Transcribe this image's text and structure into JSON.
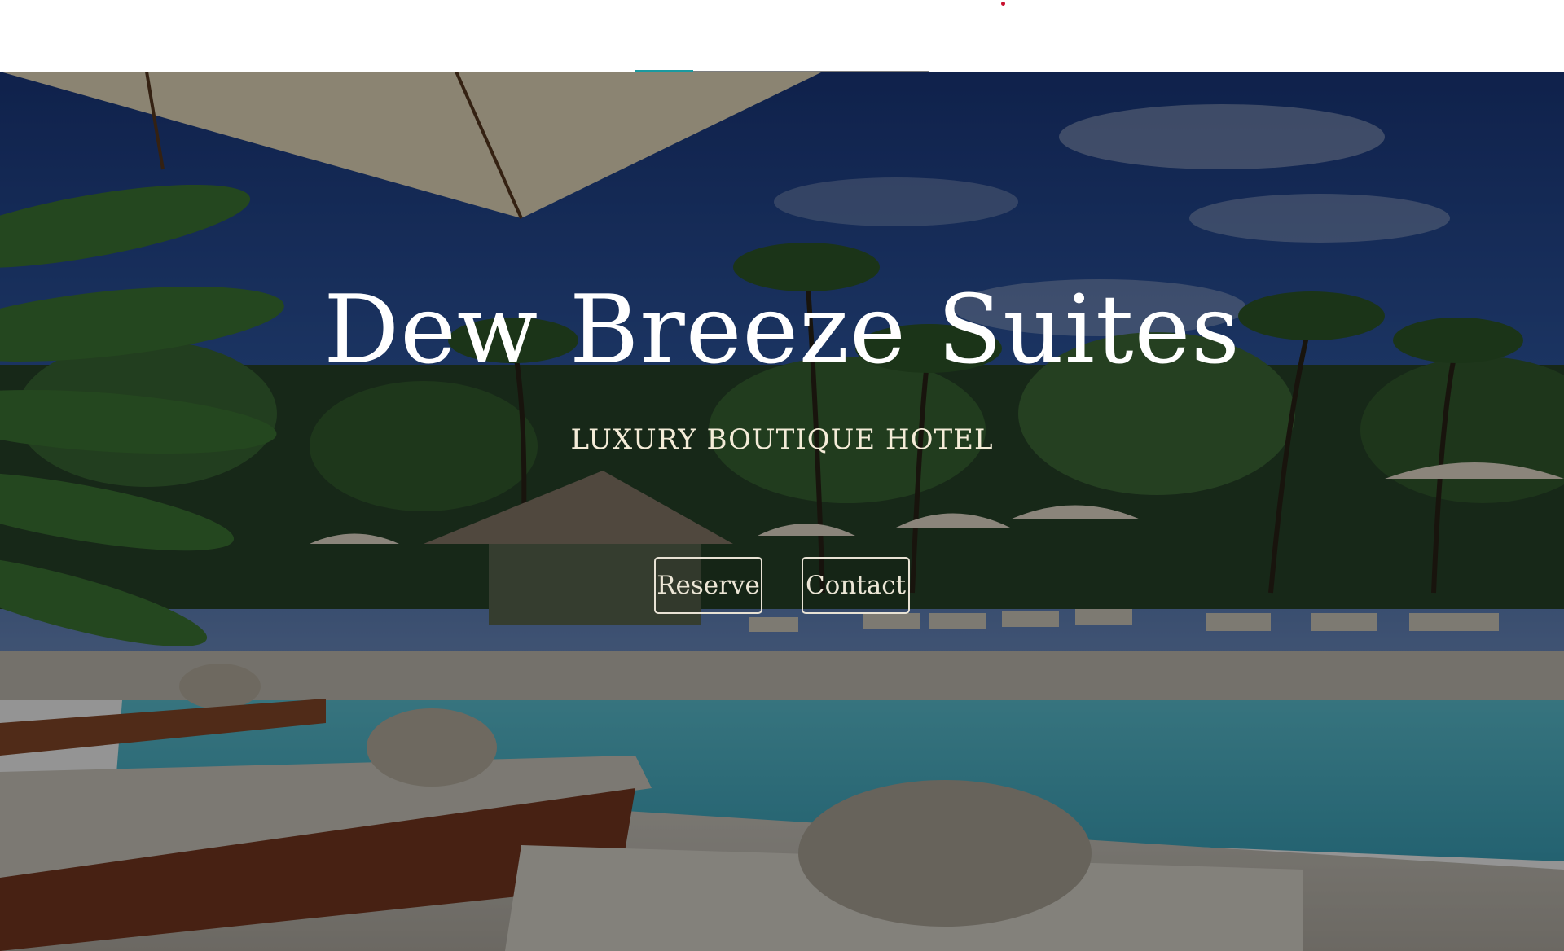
{
  "hotel": {
    "name": "Dew Breeze Suites",
    "tagline": "LUXURY BOUTIQUE HOTEL"
  },
  "actions": {
    "reserve_label": "Reserve",
    "contact_label": "Contact"
  },
  "colors": {
    "accent": "#1a9aa0",
    "overlay": "#000000",
    "text": "#ffffff",
    "notice_dot": "#c8102e"
  }
}
